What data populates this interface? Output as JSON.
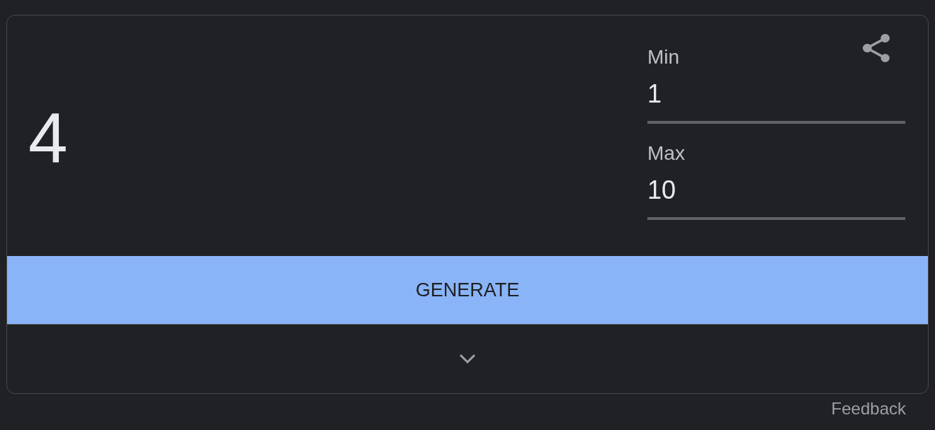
{
  "result": {
    "value": "4"
  },
  "fields": [
    {
      "label": "Min",
      "value": "1"
    },
    {
      "label": "Max",
      "value": "10"
    }
  ],
  "generate_button": {
    "label": "GENERATE"
  },
  "expander": {
    "expanded": false
  },
  "feedback_link": {
    "label": "Feedback"
  }
}
